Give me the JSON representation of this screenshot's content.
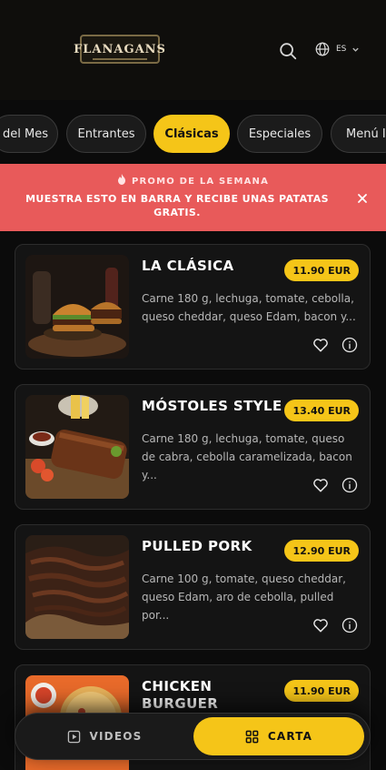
{
  "header": {
    "logo_text": "FLANAGANS",
    "language": "ES"
  },
  "tabs": [
    {
      "label": "del Mes"
    },
    {
      "label": "Entrantes"
    },
    {
      "label": "Clásicas"
    },
    {
      "label": "Especiales"
    },
    {
      "label": "Menú Ir"
    }
  ],
  "active_tab": "Clásicas",
  "promo": {
    "title": "PROMO DE LA SEMANA",
    "message": "MUESTRA ESTO EN BARRA Y RECIBE UNAS PATATAS GRATIS."
  },
  "items": [
    {
      "name": "LA CLÁSICA",
      "price": "11.90 EUR",
      "description": "Carne 180 g, lechuga, tomate, cebolla, queso cheddar, queso Edam, bacon y..."
    },
    {
      "name": "MÓSTOLES STYLE",
      "price": "13.40 EUR",
      "description": "Carne 180 g, lechuga, tomate, queso de cabra, cebolla caramelizada, bacon y..."
    },
    {
      "name": "PULLED PORK",
      "price": "12.90 EUR",
      "description": "Carne 100 g, tomate, queso cheddar, queso Edam, aro de cebolla, pulled por..."
    },
    {
      "name": "CHICKEN BURGUER",
      "price": "11.90 EUR",
      "description": ""
    }
  ],
  "bottom_nav": {
    "videos_label": "VIDEOS",
    "carta_label": "CARTA"
  },
  "colors": {
    "accent": "#f5c518",
    "promo_bg": "#e85a5a",
    "background": "#0b0b0b"
  }
}
